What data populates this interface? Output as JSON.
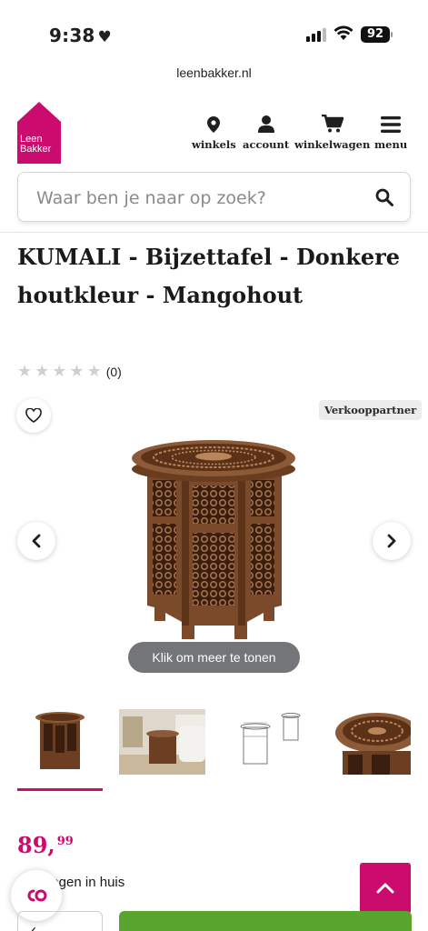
{
  "status_bar": {
    "time": "9:38",
    "battery": "92"
  },
  "browser": {
    "url": "leenbakker.nl"
  },
  "header": {
    "logo_line1": "Leen",
    "logo_line2": "Bakker",
    "nav": [
      {
        "label": "winkels",
        "icon": "location-pin-icon"
      },
      {
        "label": "account",
        "icon": "user-icon"
      },
      {
        "label": "winkelwagen",
        "icon": "cart-icon"
      },
      {
        "label": "menu",
        "icon": "hamburger-icon"
      }
    ]
  },
  "search": {
    "placeholder": "Waar ben je naar op zoek?"
  },
  "product": {
    "title": "KUMALI - Bijzettafel - Donkere houtkleur - Mangohout",
    "rating_count": "(0)",
    "rating_value": 0,
    "partner_badge": "Verkooppartner",
    "show_more": "Klik om meer te tonen",
    "price_main": "89,",
    "price_cents": "99",
    "delivery": "dagen in huis"
  },
  "colors": {
    "brand": "#cc0b6f",
    "cta": "#57a52c",
    "pill": "#737578"
  }
}
